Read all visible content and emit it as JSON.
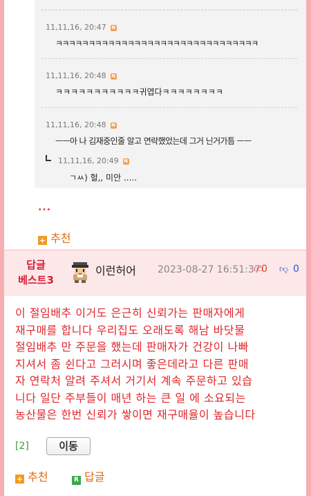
{
  "quoted_comments": [
    {
      "date": "11,11,16, 20:47",
      "badge": "N",
      "text": "ㅋㅋㅋㅋㅋㅋㅋㅋㅋㅋㅋㅋㅋㅋㅋㅋㅋㅋㅋㅋㅋㅋㅋㅋㅋㅋㅋㅋㅋㅋㅋ"
    },
    {
      "date": "11,11,16, 20:48",
      "badge": "N",
      "text": "ㅋㅋㅋㅋㅋㅋㅋㅋㅋㅋㅋ귀엽다ㅋㅋㅋㅋㅋㅋㅋㅋ"
    },
    {
      "date": "11,11,16, 20:48",
      "badge": "N",
      "text": "ㅡㅡ아 나 김재중인줄 알고 연락했었는데 그거 닌거가틈 ㅡㅡ"
    },
    {
      "date": "11,11,16, 20:49",
      "badge": "N",
      "text": "ㄱㅆ) 헐,, 미안 ....."
    }
  ],
  "more_dots": "...",
  "top_recommend": {
    "label": "추천",
    "icon": "plus-icon"
  },
  "best_reply": {
    "rank_line1": "답글",
    "rank_line2": "베스트3",
    "nickname": "이런허어",
    "date": "2023-08-27 16:51:37",
    "up_count": "0",
    "down_count": "0",
    "body_lines": [
      "이 절임배추 이거도 은근히 신뢰가는 판매자에게",
      "재구매를 합니다 우리집도 오래도록 해남 바닷물",
      "절임배추 만 주문을 했는데 판매자가 건강이 나빠",
      "지셔서 좀 쉰다고 그러시며 좋은데라고 다른 판매",
      "자 연락처 알려 주셔서 거기서 계속 주문하고 있습",
      "니다 일단 주부들이 매년 하는 큰 일 에 소요되는",
      "농산물은 한번 신뢰가 쌓이면 재구매율이 높습니다"
    ],
    "ref_count": "[2]",
    "move_button": "이동",
    "recommend_label": "추천",
    "reply_label": "답글",
    "reply_badge": "R"
  },
  "colors": {
    "frame_pink": "#f7aeb3",
    "best_bg": "#fde8e9",
    "accent_red": "#e0262b",
    "orange": "#e06a10",
    "green": "#39a94a",
    "blue": "#2d55c8"
  }
}
